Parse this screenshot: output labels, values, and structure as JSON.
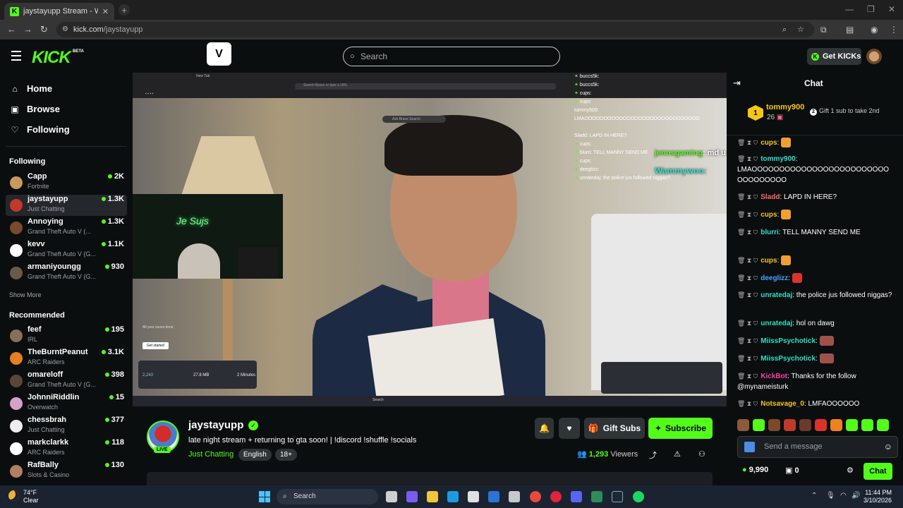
{
  "browser": {
    "tab_title": "jaystayupp Stream - Watch Live",
    "url_host": "kick.com",
    "url_path": "/jaystayupp"
  },
  "header": {
    "logo": "KICK",
    "beta": "BETA",
    "search_placeholder": "Search",
    "get_kicks": "Get KICKs"
  },
  "sidebar": {
    "nav": [
      {
        "label": "Home",
        "icon": "home-icon"
      },
      {
        "label": "Browse",
        "icon": "browse-icon"
      },
      {
        "label": "Following",
        "icon": "heart-icon"
      }
    ],
    "following_title": "Following",
    "following": [
      {
        "name": "Capp",
        "category": "Fortnite",
        "viewers": "2K",
        "color": "#c79a5b"
      },
      {
        "name": "jaystayupp",
        "category": "Just Chatting",
        "viewers": "1.3K",
        "color": "#c0392b"
      },
      {
        "name": "Annoying",
        "category": "Grand Theft Auto V (...",
        "viewers": "1.3K",
        "color": "#7a4a2a"
      },
      {
        "name": "kevv",
        "category": "Grand Theft Auto V (G...",
        "viewers": "1.1K",
        "color": "#ffffff"
      },
      {
        "name": "armaniyoungg",
        "category": "Grand Theft Auto V (G...",
        "viewers": "930",
        "color": "#6b5a4a"
      }
    ],
    "show_more": "Show More",
    "recommended_title": "Recommended",
    "recommended": [
      {
        "name": "feef",
        "category": "IRL",
        "viewers": "195",
        "color": "#8a6e5a"
      },
      {
        "name": "TheBurntPeanut",
        "category": "ARC Raiders",
        "viewers": "3.1K",
        "color": "#e67e22"
      },
      {
        "name": "omareloff",
        "category": "Grand Theft Auto V (G...",
        "viewers": "398",
        "color": "#5a4636"
      },
      {
        "name": "JohnniRiddlin",
        "category": "Overwatch",
        "viewers": "15",
        "color": "#d6a0c8"
      },
      {
        "name": "chessbrah",
        "category": "Just Chatting",
        "viewers": "377",
        "color": "#eeeeee"
      },
      {
        "name": "markclarkk",
        "category": "ARC Raiders",
        "viewers": "118",
        "color": "#ffffff"
      },
      {
        "name": "RafBally",
        "category": "Slots & Casino",
        "viewers": "130",
        "color": "#b08060"
      }
    ]
  },
  "video": {
    "overlay_user": "jennsgaming",
    "overlay_text": "md u going to the brandrisk event?",
    "overlay_user2": "Wammywoo",
    "embedded_chat": [
      "buccs5k:",
      "buccs5k:",
      "cups:",
      "cups:",
      "tommy900: LMAOOOOOOOOOOOOOOOOOOOOOOOOOOOOOO",
      "Sladd: LAPD IN HERE?",
      "cups:",
      "blurri: TELL MANNY SEND ME",
      "cups:",
      "deeglizz:",
      "unratedaj: the police jus followed niggas?"
    ],
    "inner_search": "Search Brave or type a URL",
    "inner_tab": "New Tab",
    "promo_button": "Get started",
    "stats": [
      "2,243",
      "27.8 MB",
      "2 Minutes"
    ],
    "taskbar_search": "Search",
    "neon_text": "Je Sujs"
  },
  "stream": {
    "name": "jaystayupp",
    "title": "late night stream + returning to gta soon! | !discord !shuffle !socials",
    "category": "Just Chatting",
    "tags": [
      "English",
      "18+"
    ],
    "live": "LIVE",
    "gift_subs": "Gift Subs",
    "subscribe": "Subscribe",
    "viewers_count": "1,293",
    "viewers_label": "Viewers"
  },
  "chat": {
    "title": "Chat",
    "pinned": {
      "rank": "1",
      "user": "tommy900",
      "count": "26",
      "gift_cta": "Gift 1 sub to take 2nd"
    },
    "messages": [
      {
        "user": "cups",
        "color": "#f5c518",
        "text": ""
      },
      {
        "user": "tommy900",
        "color": "#2fe0c9",
        "text": "LMAOOOOOOOOOOOOOOOOOOOOOOOOOOOOOOOOOO"
      },
      {
        "user": "Sladd",
        "color": "#ff6b6b",
        "text": "LAPD IN HERE?"
      },
      {
        "user": "cups",
        "color": "#f5c518",
        "text": ""
      },
      {
        "user": "blurri",
        "color": "#2fe0c9",
        "text": "TELL MANNY SEND ME"
      },
      {
        "user": "cups",
        "color": "#f5c518",
        "text": ""
      },
      {
        "user": "deeglizz",
        "color": "#4aa3ff",
        "text": ""
      },
      {
        "user": "unratedaj",
        "color": "#2fe0c9",
        "text": "the police jus followed niggas?"
      },
      {
        "user": "unratedaj",
        "color": "#2fe0c9",
        "text": "hol on dawg"
      },
      {
        "user": "MiissPsychotick",
        "color": "#2fe0c9",
        "text": ""
      },
      {
        "user": "MiissPsychotick",
        "color": "#2fe0c9",
        "text": ""
      },
      {
        "user": "KickBot",
        "color": "#ff3fa4",
        "text": "Thanks for the follow @mynameisturk"
      },
      {
        "user": "Notsavage_0",
        "color": "#f5c518",
        "text": "LMFAOOOOOO"
      }
    ],
    "input_placeholder": "Send a message",
    "kicks_balance": "9,990",
    "subs_balance": "0",
    "chat_button": "Chat"
  },
  "taskbar": {
    "temp": "74°F",
    "condition": "Clear",
    "search": "Search",
    "time": "11:44 PM",
    "date": "3/10/2026"
  },
  "colors": {
    "accent": "#53fc18",
    "bg": "#0b0e0f",
    "panel": "#2f3437"
  }
}
